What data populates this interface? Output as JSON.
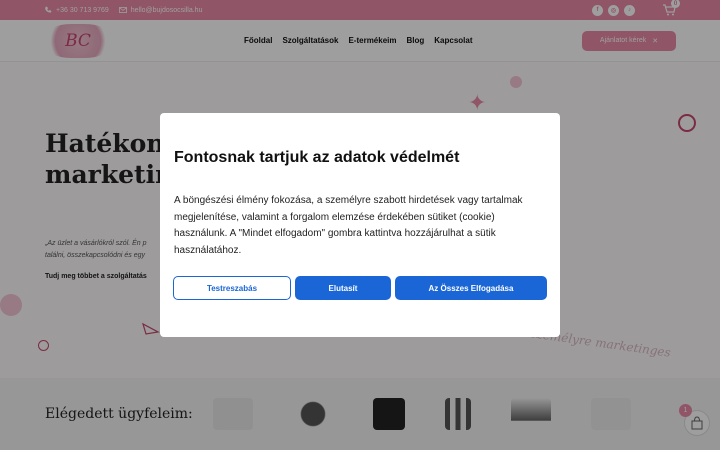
{
  "topbar": {
    "phone": "+36 30 713 9769",
    "email": "hello@bujdosocsilla.hu",
    "socials": [
      "facebook-icon",
      "instagram-icon",
      "tiktok-icon"
    ],
    "cart_count": "0"
  },
  "header": {
    "logo_text": "BC",
    "nav": [
      "Főoldal",
      "Szolgáltatások",
      "E-termékeim",
      "Blog",
      "Kapcsolat"
    ],
    "cta_label": "Ajánlatot kérek"
  },
  "hero": {
    "title_line1": "Hatékony",
    "title_line2": "marketing",
    "quote_line1": "„Az üzlet a vásárlókról szól. Én p",
    "quote_line2": "találni, összekapcsolódni és egy",
    "link": "Tudj meg többet a szolgáltatás",
    "script_text": "személyre marketinges"
  },
  "clients": {
    "title": "Elégedett ügyfeleim:",
    "float_count": "1"
  },
  "cookie_modal": {
    "title": "Fontosnak tartjuk az adatok védelmét",
    "body": "A böngészési élmény fokozása, a személyre szabott hirdetések vagy tartalmak megjelenítése, valamint a forgalom elemzése érdekében sütiket (cookie) használunk. A \"Mindet elfogadom\" gombra kattintva hozzájárulhat a sütik használatához.",
    "customize_label": "Testreszabás",
    "reject_label": "Elutasít",
    "accept_label": "Az Összes Elfogadása"
  },
  "colors": {
    "brand_pink": "#e98aa6",
    "accent_blue": "#1a66d6"
  }
}
